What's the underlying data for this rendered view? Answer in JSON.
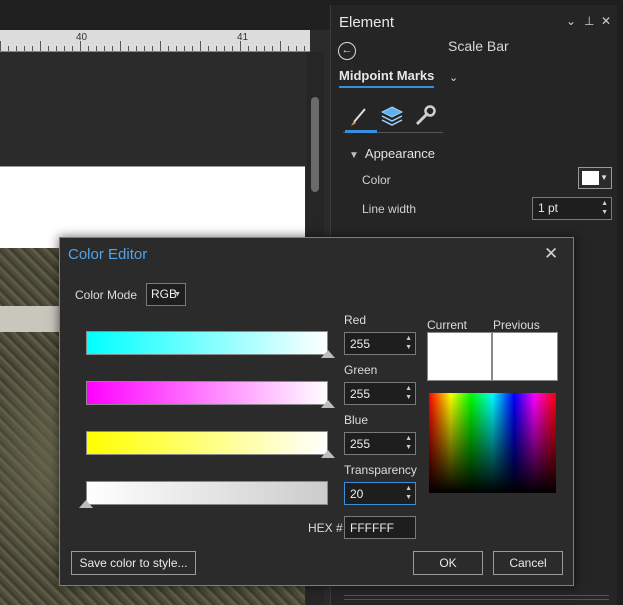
{
  "layout_view": {
    "ruler_numbers": [
      "40",
      "41"
    ]
  },
  "element_pane": {
    "title": "Element",
    "controls": {
      "options": "⌄",
      "pin": "⊥",
      "close": "✕"
    },
    "back_glyph": "←",
    "subtitle": "Scale Bar",
    "selected_element": "Midpoint Marks",
    "tabs": [
      {
        "icon": "paintbrush-icon",
        "active": true
      },
      {
        "icon": "layers-icon",
        "active": false
      },
      {
        "icon": "wrench-icon",
        "active": false
      }
    ],
    "section_title": "Appearance",
    "color_label": "Color",
    "color_value": "#ffffff",
    "line_width_label": "Line width",
    "line_width_value": "1 pt"
  },
  "color_editor": {
    "title": "Color Editor",
    "close_glyph": "✕",
    "color_mode_label": "Color Mode",
    "color_mode_value": "RGB",
    "channels": [
      {
        "label": "Red",
        "value": "255",
        "gradient_from": "#00ffff",
        "gradient_to": "#ffffff",
        "level": 1.0
      },
      {
        "label": "Green",
        "value": "255",
        "gradient_from": "#ff00ff",
        "gradient_to": "#ffffff",
        "level": 1.0
      },
      {
        "label": "Blue",
        "value": "255",
        "gradient_from": "#ffff00",
        "gradient_to": "#ffffff",
        "level": 1.0
      },
      {
        "label": "Transparency",
        "value": "20",
        "gradient_from": "#ffffff",
        "gradient_to": "#cccccc",
        "level": 0.0
      }
    ],
    "current_label": "Current",
    "previous_label": "Previous",
    "current_color": "#ffffff",
    "previous_color": "#ffffff",
    "hex_label": "HEX #",
    "hex_value": "FFFFFF",
    "save_button": "Save color to style...",
    "ok_button": "OK",
    "cancel_button": "Cancel"
  },
  "colors": {
    "accent": "#3a8edc",
    "dialog_bg": "#2b2b2b",
    "pane_bg": "#252526"
  }
}
